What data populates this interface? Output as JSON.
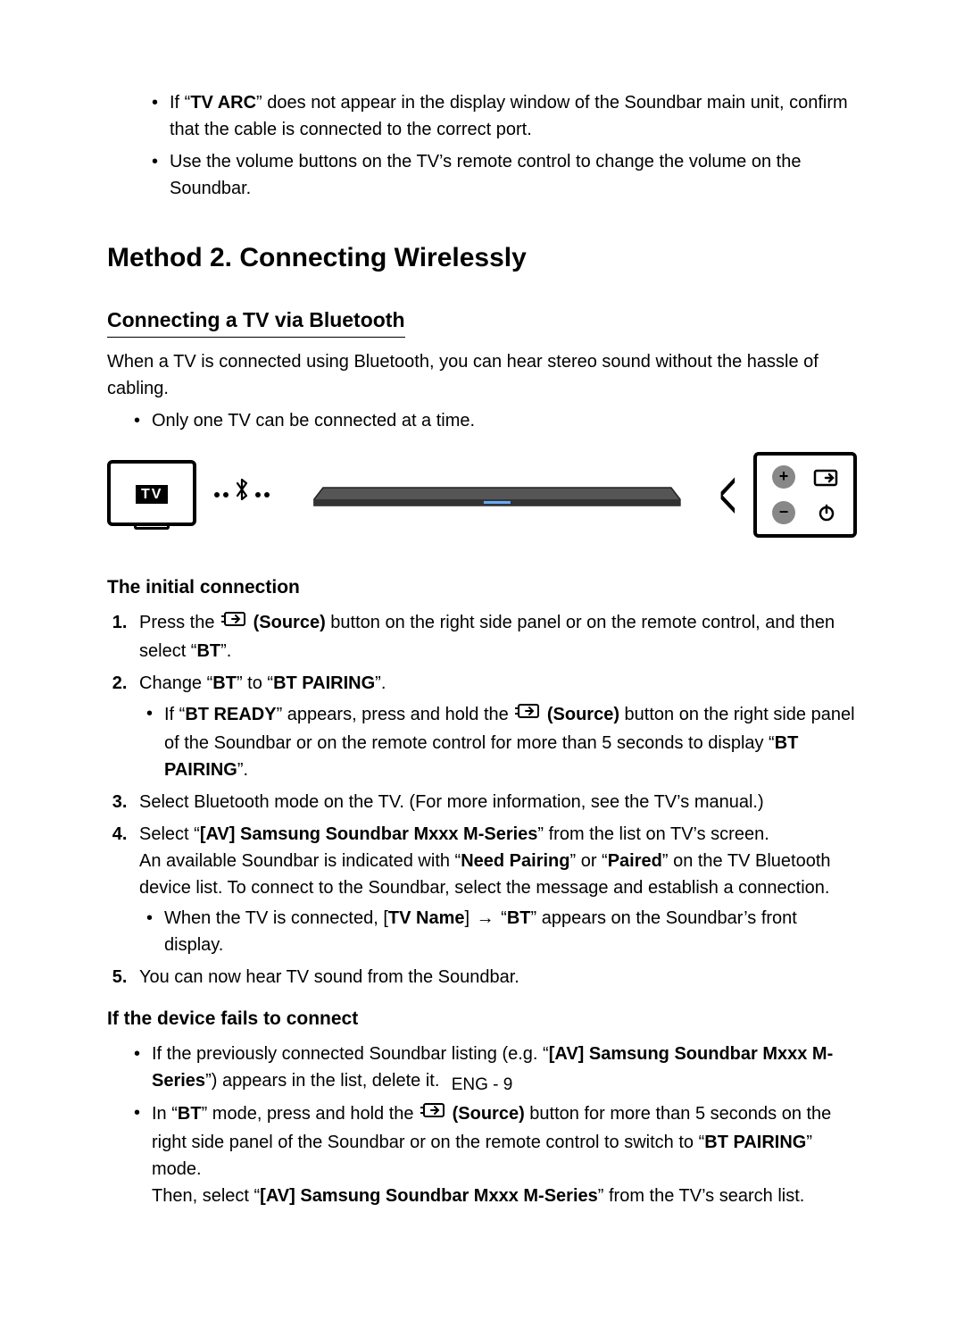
{
  "notes": {
    "arc": {
      "pre": "If “",
      "bold": "TV ARC",
      "post": "” does not appear in the display window of the Soundbar main unit, confirm that the cable is connected to the correct port."
    },
    "volume": "Use the volume buttons on the TV’s remote control to change the volume on the Soundbar."
  },
  "method2_title": "Method 2. Connecting Wirelessly",
  "bt_heading": "Connecting a TV via Bluetooth",
  "bt_intro": "When a TV is connected using Bluetooth, you can hear stereo sound without the hassle of cabling.",
  "bt_note": "Only one TV can be connected at a time.",
  "tv_label": "TV",
  "initial_heading": "The initial connection",
  "steps": {
    "s1": {
      "pre": "Press the ",
      "btn": "(Source)",
      "mid": " button on the right side panel or on the remote control, and then select “",
      "bt": "BT",
      "post": "”."
    },
    "s2": {
      "pre": "Change “",
      "bt": "BT",
      "mid": "” to “",
      "pair": "BT PAIRING",
      "post": "”."
    },
    "s2sub": {
      "pre": "If “",
      "ready": "BT READY",
      "mid1": "” appears, press and hold the ",
      "btn": "(Source)",
      "mid2": " button on the right side panel of the Soundbar or on the remote control for more than 5 seconds to display “",
      "pair": "BT PAIRING",
      "post": "”."
    },
    "s3": "Select Bluetooth mode on the TV. (For more information, see the TV’s manual.)",
    "s4": {
      "pre": "Select “",
      "dev": "[AV] Samsung Soundbar Mxxx M-Series",
      "post": "” from the list on TV’s screen."
    },
    "s4b": {
      "pre": "An available Soundbar is indicated with “",
      "np": "Need Pairing",
      "mid": "” or “",
      "pd": "Paired",
      "post": "” on the TV Bluetooth device list. To connect to the Soundbar, select the message and establish a connection."
    },
    "s4sub": {
      "pre": "When the TV is connected, [",
      "tvn": "TV Name",
      "mid": "] ",
      "arrow": "→",
      "mid2": " “",
      "bt": "BT",
      "post": "” appears on the Soundbar’s front display."
    },
    "s5": "You can now hear TV sound from the Soundbar."
  },
  "fail_heading": "If the device fails to connect",
  "fail": {
    "f1": {
      "pre": "If the previously connected Soundbar listing (e.g. “",
      "dev": "[AV] Samsung Soundbar Mxxx M-Series",
      "post": "”) appears in the list, delete it."
    },
    "f2": {
      "pre": "In “",
      "bt": "BT",
      "mid1": "” mode, press and hold the ",
      "btn": "(Source)",
      "mid2": " button for more than 5 seconds on the right side panel of the Soundbar or on the remote control to switch to “",
      "pair": "BT PAIRING",
      "post": "” mode."
    },
    "f2b": {
      "pre": "Then, select “",
      "dev": "[AV] Samsung Soundbar Mxxx M-Series",
      "post": "” from the TV’s search list."
    }
  },
  "footer": "ENG - 9"
}
